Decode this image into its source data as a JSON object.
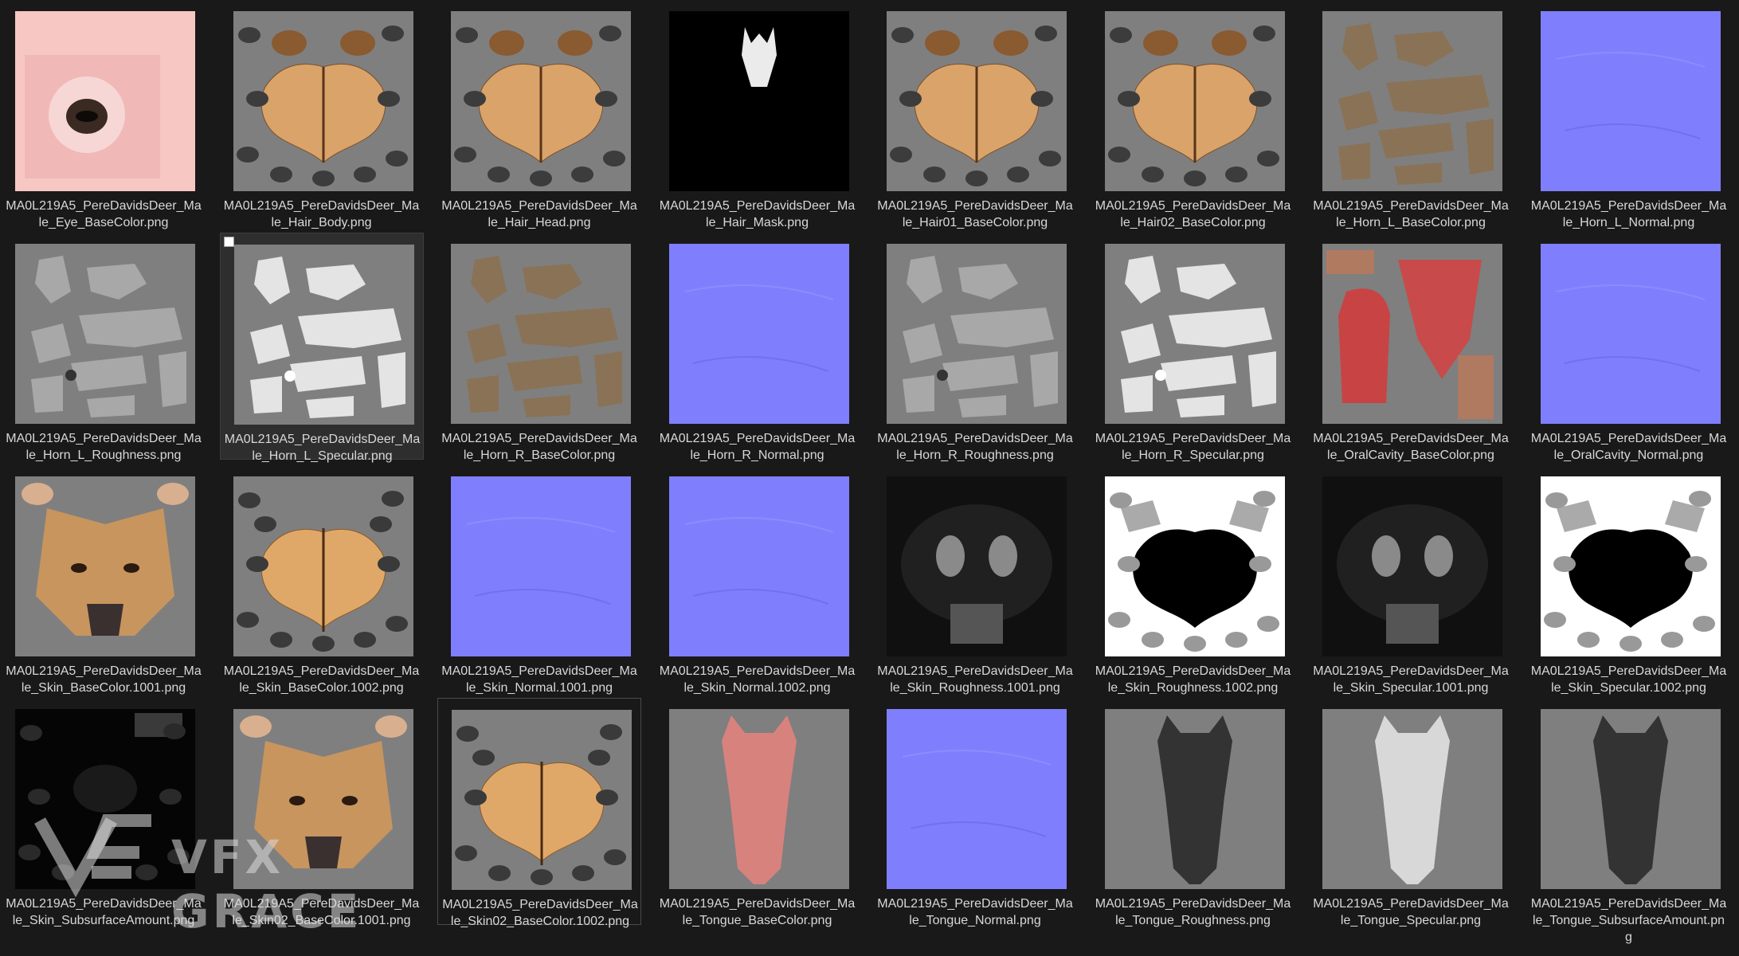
{
  "colors": {
    "background": "#191919",
    "caption_text": "#d8d8d8",
    "selection_bg": "#2e2e2e",
    "normal_map_blue": "#7f7ffe"
  },
  "files": [
    {
      "line1": "MA0L219A5_PereDavidsDeer_Ma",
      "line2": "le_Eye_BaseColor.png",
      "line3": "",
      "kind": "eye"
    },
    {
      "line1": "MA0L219A5_PereDavidsDeer_Ma",
      "line2": "le_Hair_Body.png",
      "line3": "",
      "kind": "pelt"
    },
    {
      "line1": "MA0L219A5_PereDavidsDeer_Ma",
      "line2": "le_Hair_Head.png",
      "line3": "",
      "kind": "pelt"
    },
    {
      "line1": "MA0L219A5_PereDavidsDeer_Ma",
      "line2": "le_Hair_Mask.png",
      "line3": "",
      "kind": "mask"
    },
    {
      "line1": "MA0L219A5_PereDavidsDeer_Ma",
      "line2": "le_Hair01_BaseColor.png",
      "line3": "",
      "kind": "pelt"
    },
    {
      "line1": "MA0L219A5_PereDavidsDeer_Ma",
      "line2": "le_Hair02_BaseColor.png",
      "line3": "",
      "kind": "pelt"
    },
    {
      "line1": "MA0L219A5_PereDavidsDeer_Ma",
      "line2": "le_Horn_L_BaseColor.png",
      "line3": "",
      "kind": "horn_color"
    },
    {
      "line1": "MA0L219A5_PereDavidsDeer_Ma",
      "line2": "le_Horn_L_Normal.png",
      "line3": "",
      "kind": "normal"
    },
    {
      "line1": "MA0L219A5_PereDavidsDeer_Ma",
      "line2": "le_Horn_L_Roughness.png",
      "line3": "",
      "kind": "horn_rough"
    },
    {
      "line1": "MA0L219A5_PereDavidsDeer_Ma",
      "line2": "le_Horn_L_Specular.png",
      "line3": "",
      "kind": "horn_spec",
      "selected": true
    },
    {
      "line1": "MA0L219A5_PereDavidsDeer_Ma",
      "line2": "le_Horn_R_BaseColor.png",
      "line3": "",
      "kind": "horn_color"
    },
    {
      "line1": "MA0L219A5_PereDavidsDeer_Ma",
      "line2": "le_Horn_R_Normal.png",
      "line3": "",
      "kind": "normal"
    },
    {
      "line1": "MA0L219A5_PereDavidsDeer_Ma",
      "line2": "le_Horn_R_Roughness.png",
      "line3": "",
      "kind": "horn_rough"
    },
    {
      "line1": "MA0L219A5_PereDavidsDeer_Ma",
      "line2": "le_Horn_R_Specular.png",
      "line3": "",
      "kind": "horn_spec"
    },
    {
      "line1": "MA0L219A5_PereDavidsDeer_Ma",
      "line2": "le_OralCavity_BaseColor.png",
      "line3": "",
      "kind": "oral"
    },
    {
      "line1": "MA0L219A5_PereDavidsDeer_Ma",
      "line2": "le_OralCavity_Normal.png",
      "line3": "",
      "kind": "normal"
    },
    {
      "line1": "MA0L219A5_PereDavidsDeer_Ma",
      "line2": "le_Skin_BaseColor.1001.png",
      "line3": "",
      "kind": "face"
    },
    {
      "line1": "MA0L219A5_PereDavidsDeer_Ma",
      "line2": "le_Skin_BaseColor.1002.png",
      "line3": "",
      "kind": "body"
    },
    {
      "line1": "MA0L219A5_PereDavidsDeer_Ma",
      "line2": "le_Skin_Normal.1001.png",
      "line3": "",
      "kind": "normal"
    },
    {
      "line1": "MA0L219A5_PereDavidsDeer_Ma",
      "line2": "le_Skin_Normal.1002.png",
      "line3": "",
      "kind": "normal"
    },
    {
      "line1": "MA0L219A5_PereDavidsDeer_Ma",
      "line2": "le_Skin_Roughness.1001.png",
      "line3": "",
      "kind": "dark_face"
    },
    {
      "line1": "MA0L219A5_PereDavidsDeer_Ma",
      "line2": "le_Skin_Roughness.1002.png",
      "line3": "",
      "kind": "bw_pelt"
    },
    {
      "line1": "MA0L219A5_PereDavidsDeer_Ma",
      "line2": "le_Skin_Specular.1001.png",
      "line3": "",
      "kind": "dark_face"
    },
    {
      "line1": "MA0L219A5_PereDavidsDeer_Ma",
      "line2": "le_Skin_Specular.1002.png",
      "line3": "",
      "kind": "bw_pelt"
    },
    {
      "line1": "MA0L219A5_PereDavidsDeer_Ma",
      "line2": "le_Skin_SubsurfaceAmount.png",
      "line3": "",
      "kind": "subsurface"
    },
    {
      "line1": "MA0L219A5_PereDavidsDeer_Ma",
      "line2": "le_Skin02_BaseColor.1001.png",
      "line3": "",
      "kind": "face"
    },
    {
      "line1": "MA0L219A5_PereDavidsDeer_Ma",
      "line2": "le_Skin02_BaseColor.1002.png",
      "line3": "",
      "kind": "body",
      "focused": true
    },
    {
      "line1": "MA0L219A5_PereDavidsDeer_Ma",
      "line2": "le_Tongue_BaseColor.png",
      "line3": "",
      "kind": "tongue_pink"
    },
    {
      "line1": "MA0L219A5_PereDavidsDeer_Ma",
      "line2": "le_Tongue_Normal.png",
      "line3": "",
      "kind": "normal"
    },
    {
      "line1": "MA0L219A5_PereDavidsDeer_Ma",
      "line2": "le_Tongue_Roughness.png",
      "line3": "",
      "kind": "tongue_dark"
    },
    {
      "line1": "MA0L219A5_PereDavidsDeer_Ma",
      "line2": "le_Tongue_Specular.png",
      "line3": "",
      "kind": "tongue_light"
    },
    {
      "line1": "MA0L219A5_PereDavidsDeer_Ma",
      "line2": "le_Tongue_SubsurfaceAmount.pn",
      "line3": "g",
      "kind": "tongue_dark"
    }
  ],
  "watermark": {
    "text": "VFX GRACE",
    "icon": "vfx-grace-logo-icon"
  }
}
